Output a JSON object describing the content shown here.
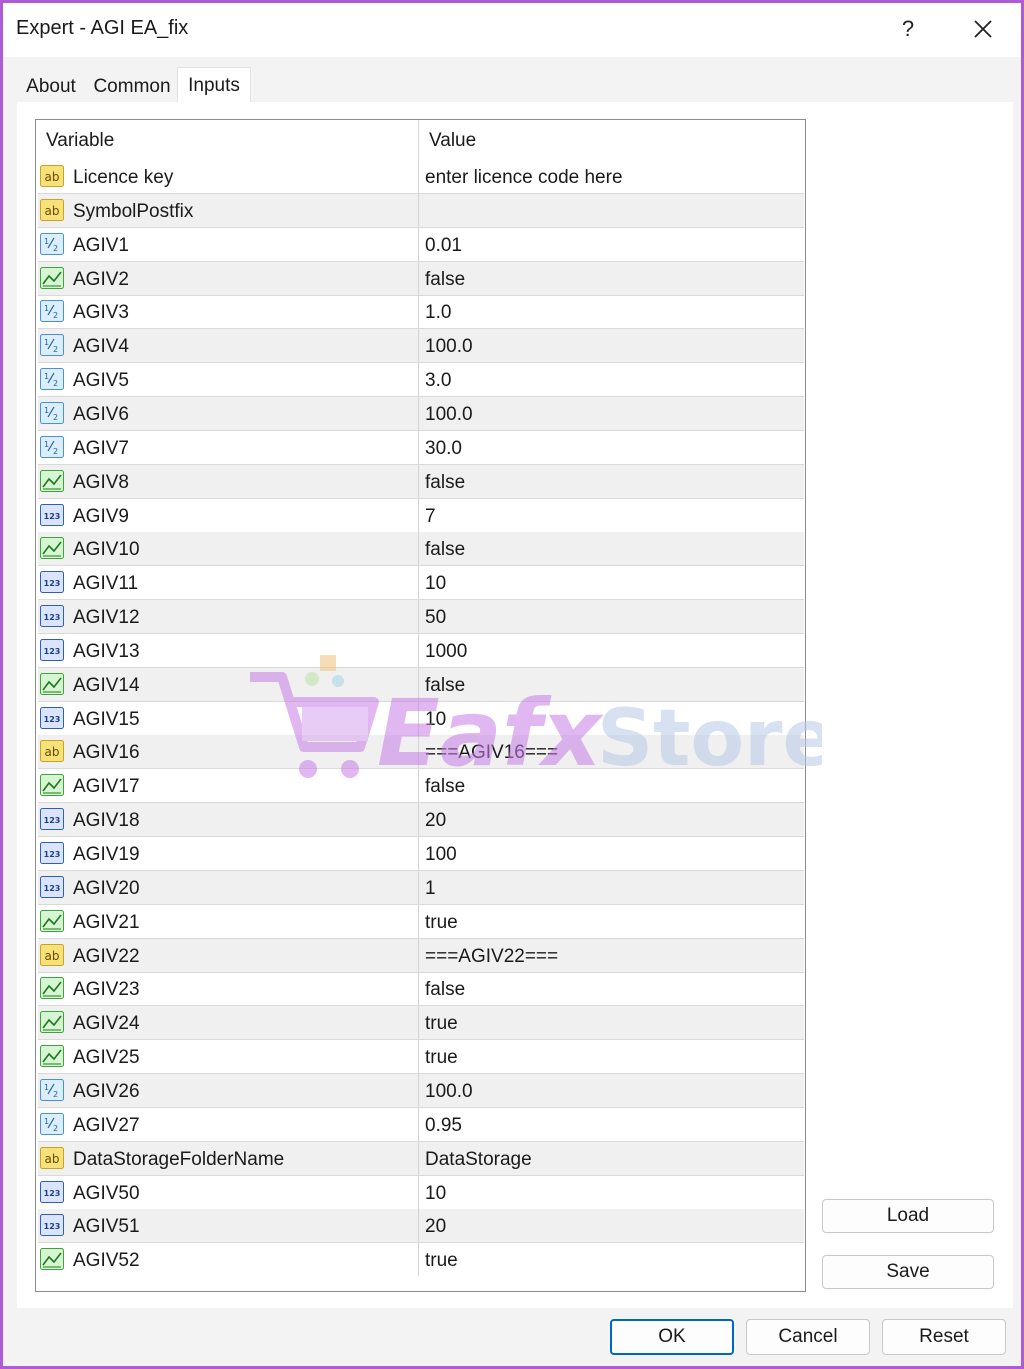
{
  "window": {
    "title": "Expert - AGI EA_fix",
    "help_label": "?"
  },
  "tabs": [
    {
      "label": "About",
      "active": false
    },
    {
      "label": "Common",
      "active": false
    },
    {
      "label": "Inputs",
      "active": true
    }
  ],
  "grid": {
    "columns": [
      "Variable",
      "Value"
    ],
    "rows": [
      {
        "type": "string",
        "icon": "string-ab-icon",
        "variable": "Licence key",
        "value": "enter licence code here"
      },
      {
        "type": "string",
        "icon": "string-ab-icon",
        "variable": "SymbolPostfix",
        "value": ""
      },
      {
        "type": "double",
        "icon": "double-half-icon",
        "variable": "AGIV1",
        "value": "0.01"
      },
      {
        "type": "bool",
        "icon": "bool-chart-icon",
        "variable": "AGIV2",
        "value": "false"
      },
      {
        "type": "double",
        "icon": "double-half-icon",
        "variable": "AGIV3",
        "value": "1.0"
      },
      {
        "type": "double",
        "icon": "double-half-icon",
        "variable": "AGIV4",
        "value": "100.0"
      },
      {
        "type": "double",
        "icon": "double-half-icon",
        "variable": "AGIV5",
        "value": "3.0"
      },
      {
        "type": "double",
        "icon": "double-half-icon",
        "variable": "AGIV6",
        "value": "100.0"
      },
      {
        "type": "double",
        "icon": "double-half-icon",
        "variable": "AGIV7",
        "value": "30.0"
      },
      {
        "type": "bool",
        "icon": "bool-chart-icon",
        "variable": "AGIV8",
        "value": "false"
      },
      {
        "type": "int",
        "icon": "int-123-icon",
        "variable": "AGIV9",
        "value": "7"
      },
      {
        "type": "bool",
        "icon": "bool-chart-icon",
        "variable": "AGIV10",
        "value": "false"
      },
      {
        "type": "int",
        "icon": "int-123-icon",
        "variable": "AGIV11",
        "value": "10"
      },
      {
        "type": "int",
        "icon": "int-123-icon",
        "variable": "AGIV12",
        "value": "50"
      },
      {
        "type": "int",
        "icon": "int-123-icon",
        "variable": "AGIV13",
        "value": "1000"
      },
      {
        "type": "bool",
        "icon": "bool-chart-icon",
        "variable": "AGIV14",
        "value": "false"
      },
      {
        "type": "int",
        "icon": "int-123-icon",
        "variable": "AGIV15",
        "value": "10"
      },
      {
        "type": "string",
        "icon": "string-ab-icon",
        "variable": "AGIV16",
        "value": "===AGIV16==="
      },
      {
        "type": "bool",
        "icon": "bool-chart-icon",
        "variable": "AGIV17",
        "value": "false"
      },
      {
        "type": "int",
        "icon": "int-123-icon",
        "variable": "AGIV18",
        "value": "20"
      },
      {
        "type": "int",
        "icon": "int-123-icon",
        "variable": "AGIV19",
        "value": "100"
      },
      {
        "type": "int",
        "icon": "int-123-icon",
        "variable": "AGIV20",
        "value": "1"
      },
      {
        "type": "bool",
        "icon": "bool-chart-icon",
        "variable": "AGIV21",
        "value": "true"
      },
      {
        "type": "string",
        "icon": "string-ab-icon",
        "variable": "AGIV22",
        "value": "===AGIV22==="
      },
      {
        "type": "bool",
        "icon": "bool-chart-icon",
        "variable": "AGIV23",
        "value": "false"
      },
      {
        "type": "bool",
        "icon": "bool-chart-icon",
        "variable": "AGIV24",
        "value": "true"
      },
      {
        "type": "bool",
        "icon": "bool-chart-icon",
        "variable": "AGIV25",
        "value": "true"
      },
      {
        "type": "double",
        "icon": "double-half-icon",
        "variable": "AGIV26",
        "value": "100.0"
      },
      {
        "type": "double",
        "icon": "double-half-icon",
        "variable": "AGIV27",
        "value": "0.95"
      },
      {
        "type": "string",
        "icon": "string-ab-icon",
        "variable": "DataStorageFolderName",
        "value": "DataStorage"
      },
      {
        "type": "int",
        "icon": "int-123-icon",
        "variable": "AGIV50",
        "value": "10"
      },
      {
        "type": "int",
        "icon": "int-123-icon",
        "variable": "AGIV51",
        "value": "20"
      },
      {
        "type": "bool",
        "icon": "bool-chart-icon",
        "variable": "AGIV52",
        "value": "true"
      }
    ]
  },
  "side_buttons": {
    "load": "Load",
    "save": "Save"
  },
  "footer": {
    "ok": "OK",
    "cancel": "Cancel",
    "reset": "Reset"
  },
  "watermark": {
    "text_a": "Eafx",
    "text_b": "Store"
  },
  "colors": {
    "accent": "#0067c0",
    "frame": "#b05bd6",
    "alt_row": "#f0f0f0"
  }
}
